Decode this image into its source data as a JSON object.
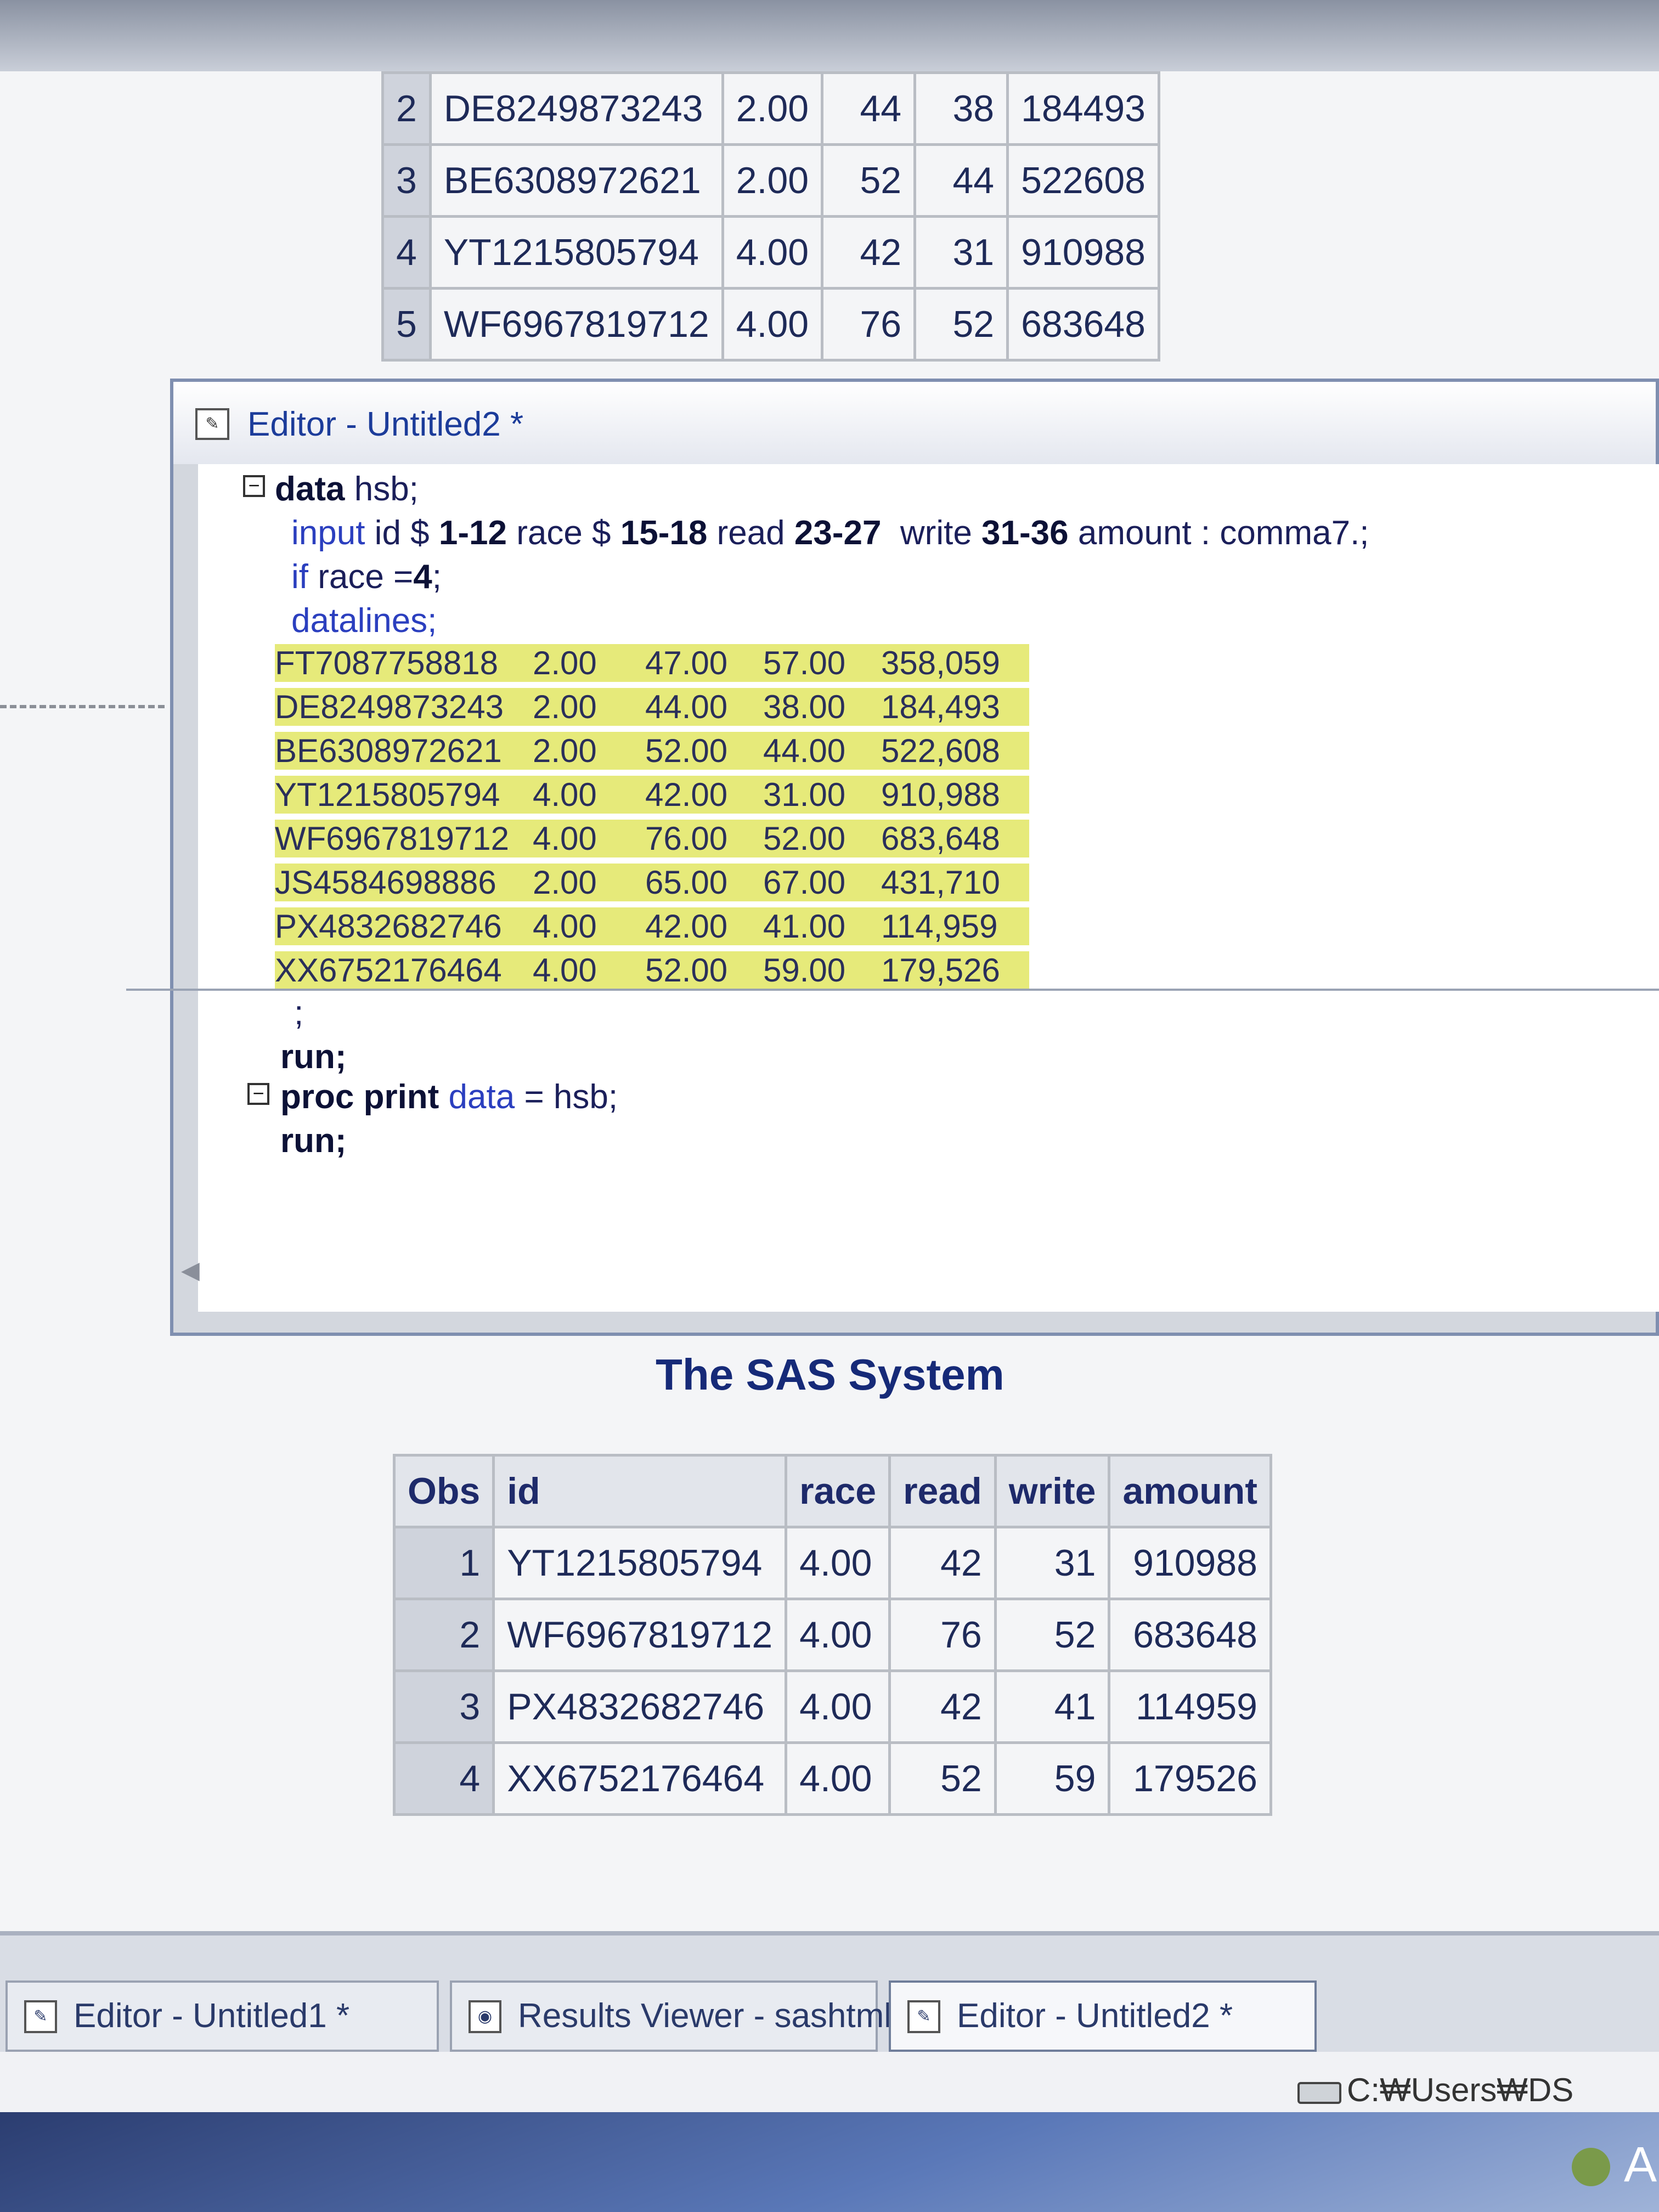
{
  "top_table": {
    "rows": [
      {
        "obs": "2",
        "id": "DE8249873243",
        "race": "2.00",
        "read": "44",
        "write": "38",
        "amount": "184493"
      },
      {
        "obs": "3",
        "id": "BE6308972621",
        "race": "2.00",
        "read": "52",
        "write": "44",
        "amount": "522608"
      },
      {
        "obs": "4",
        "id": "YT1215805794",
        "race": "4.00",
        "read": "42",
        "write": "31",
        "amount": "910988"
      },
      {
        "obs": "5",
        "id": "WF6967819712",
        "race": "4.00",
        "read": "76",
        "write": "52",
        "amount": "683648"
      }
    ]
  },
  "editor": {
    "title": "Editor - Untitled2 *",
    "code": {
      "line1_kw": "data",
      "line1_rest": " hsb;",
      "line2_input": "input",
      "line2_a": " id $ ",
      "line2_b": "1-12",
      "line2_c": " race $ ",
      "line2_d": "15-18",
      "line2_e": " read ",
      "line2_f": "23-27",
      "line2_g": "  write ",
      "line2_h": "31-36",
      "line2_i": " amount : comma7.;",
      "line3_if": "if",
      "line3_rest": " race =",
      "line3_val": "4",
      "line3_end": ";",
      "line4": "datalines;",
      "semicolon": ";",
      "run1": "run;",
      "proc_kw": "proc print",
      "proc_data": " data",
      "proc_rest": " = hsb;",
      "run2": "run;"
    },
    "datalines": [
      [
        "FT7087758818",
        "2.00",
        "47.00",
        "57.00",
        "358,059"
      ],
      [
        "DE8249873243",
        "2.00",
        "44.00",
        "38.00",
        "184,493"
      ],
      [
        "BE6308972621",
        "2.00",
        "52.00",
        "44.00",
        "522,608"
      ],
      [
        "YT1215805794",
        "4.00",
        "42.00",
        "31.00",
        "910,988"
      ],
      [
        "WF6967819712",
        "4.00",
        "76.00",
        "52.00",
        "683,648"
      ],
      [
        "JS4584698886",
        "2.00",
        "65.00",
        "67.00",
        "431,710"
      ],
      [
        "PX4832682746",
        "4.00",
        "42.00",
        "41.00",
        "114,959"
      ],
      [
        "XX6752176464",
        "4.00",
        "52.00",
        "59.00",
        "179,526"
      ]
    ]
  },
  "output": {
    "title": "The SAS System",
    "headers": {
      "obs": "Obs",
      "id": "id",
      "race": "race",
      "read": "read",
      "write": "write",
      "amount": "amount"
    },
    "rows": [
      {
        "obs": "1",
        "id": "YT1215805794",
        "race": "4.00",
        "read": "42",
        "write": "31",
        "amount": "910988"
      },
      {
        "obs": "2",
        "id": "WF6967819712",
        "race": "4.00",
        "read": "76",
        "write": "52",
        "amount": "683648"
      },
      {
        "obs": "3",
        "id": "PX4832682746",
        "race": "4.00",
        "read": "42",
        "write": "41",
        "amount": "114959"
      },
      {
        "obs": "4",
        "id": "XX6752176464",
        "race": "4.00",
        "read": "52",
        "write": "59",
        "amount": "179526"
      }
    ]
  },
  "taskbar": {
    "items": [
      {
        "label": "Editor - Untitled1 *",
        "icon": "editor-icon"
      },
      {
        "label": "Results Viewer - sashtml",
        "icon": "results-viewer-icon"
      },
      {
        "label": "Editor - Untitled2 *",
        "icon": "editor-icon"
      }
    ]
  },
  "status": {
    "path": "C:₩Users₩DS"
  },
  "corner_text": "A"
}
